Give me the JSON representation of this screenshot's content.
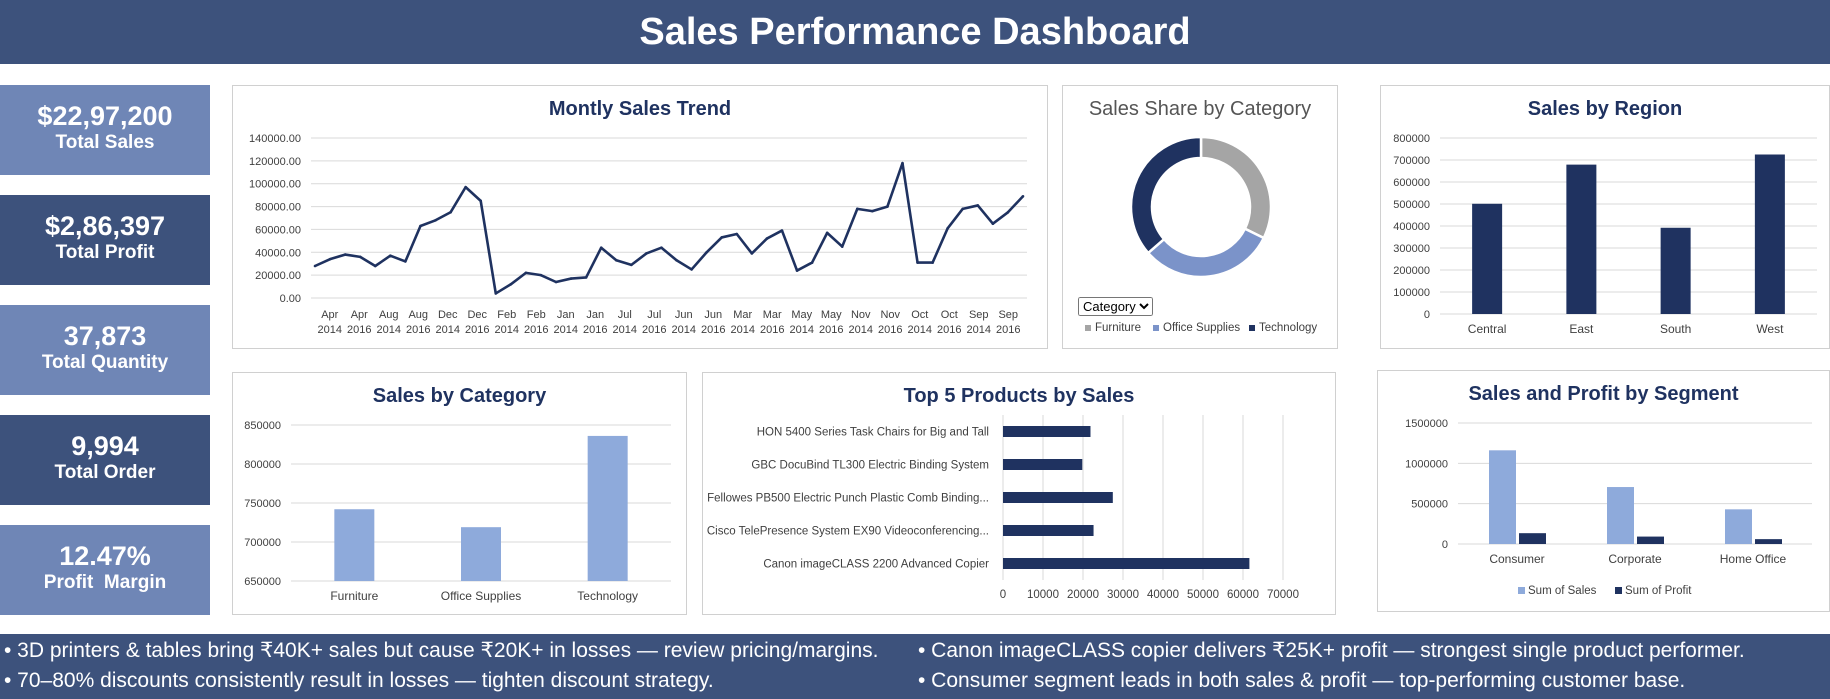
{
  "header": {
    "title": "Sales Performance Dashboard"
  },
  "kpis": [
    {
      "value": "$22,97,200",
      "label": "Total Sales",
      "style": "light"
    },
    {
      "value": "$2,86,397",
      "label": "Total Profit",
      "style": "dark"
    },
    {
      "value": "37,873",
      "label": "Total Quantity",
      "style": "light"
    },
    {
      "value": "9,994",
      "label": "Total Order",
      "style": "dark"
    },
    {
      "value": "12.47%",
      "label": "Profit  Margin",
      "style": "light"
    }
  ],
  "colors": {
    "header": "#3d527c",
    "kpi_light": "#6f86b6",
    "kpi_dark": "#3d527c",
    "navy": "#1f3260",
    "light_blue": "#8eaadb",
    "grey": "#a5a5a5",
    "mid_blue": "#7b93c9"
  },
  "share_filter": {
    "selected": "Category"
  },
  "insights": [
    "• 3D printers & tables bring ₹40K+ sales but cause ₹20K+ in losses — review pricing/margins.",
    "• 70–80% discounts consistently result in losses — tighten discount strategy.",
    "• Canon imageCLASS copier delivers ₹25K+ profit — strongest single product performer.",
    "• Consumer segment leads in both sales & profit — top-performing customer base."
  ],
  "chart_data": [
    {
      "id": "monthly",
      "type": "line",
      "title": "Montly Sales Trend",
      "ylim": [
        0,
        140000
      ],
      "yticks": [
        "0.00",
        "20000.00",
        "40000.00",
        "60000.00",
        "80000.00",
        "100000.00",
        "120000.00",
        "140000.00"
      ],
      "x_labels": [
        [
          "Apr",
          "2014"
        ],
        [
          "Apr",
          "2016"
        ],
        [
          "Aug",
          "2014"
        ],
        [
          "Aug",
          "2016"
        ],
        [
          "Dec",
          "2014"
        ],
        [
          "Dec",
          "2016"
        ],
        [
          "Feb",
          "2014"
        ],
        [
          "Feb",
          "2016"
        ],
        [
          "Jan",
          "2014"
        ],
        [
          "Jan",
          "2016"
        ],
        [
          "Jul",
          "2014"
        ],
        [
          "Jul",
          "2016"
        ],
        [
          "Jun",
          "2014"
        ],
        [
          "Jun",
          "2016"
        ],
        [
          "Mar",
          "2014"
        ],
        [
          "Mar",
          "2016"
        ],
        [
          "May",
          "2014"
        ],
        [
          "May",
          "2016"
        ],
        [
          "Nov",
          "2014"
        ],
        [
          "Nov",
          "2016"
        ],
        [
          "Oct",
          "2014"
        ],
        [
          "Oct",
          "2016"
        ],
        [
          "Sep",
          "2014"
        ],
        [
          "Sep",
          "2016"
        ]
      ],
      "values": [
        28000,
        34000,
        38000,
        36000,
        28000,
        37000,
        32000,
        63000,
        68000,
        75000,
        97000,
        85000,
        4000,
        12000,
        22000,
        20000,
        14000,
        17000,
        18000,
        44000,
        33000,
        29000,
        39000,
        44000,
        33000,
        25000,
        40000,
        53000,
        56000,
        39000,
        52000,
        59000,
        24000,
        31000,
        57000,
        45000,
        78000,
        76000,
        80000,
        118000,
        31000,
        31000,
        61000,
        78000,
        81000,
        65000,
        75000,
        89000
      ],
      "grid": true
    },
    {
      "id": "share",
      "type": "pie",
      "title": "Sales Share by Category",
      "categories": [
        "Furniture",
        "Office Supplies",
        "Technology"
      ],
      "values": [
        742000,
        719000,
        836000
      ],
      "legend": "bottom"
    },
    {
      "id": "region",
      "type": "bar",
      "title": "Sales by Region",
      "categories": [
        "Central",
        "East",
        "South",
        "West"
      ],
      "values": [
        501000,
        679000,
        392000,
        725000
      ],
      "ylim": [
        0,
        800000
      ],
      "yticks": [
        "0",
        "100000",
        "200000",
        "300000",
        "400000",
        "500000",
        "600000",
        "700000",
        "800000"
      ],
      "grid": true
    },
    {
      "id": "category",
      "type": "bar",
      "title": "Sales by Category",
      "categories": [
        "Furniture",
        "Office Supplies",
        "Technology"
      ],
      "values": [
        742000,
        719000,
        836000
      ],
      "ylim": [
        650000,
        850000
      ],
      "yticks": [
        "650000",
        "700000",
        "750000",
        "800000",
        "850000"
      ],
      "grid": true
    },
    {
      "id": "top5",
      "type": "bar",
      "title": "Top 5 Products by Sales",
      "categories": [
        "HON 5400 Series Task Chairs for Big and Tall",
        "GBC DocuBind TL300 Electric Binding System",
        "Fellowes PB500 Electric Punch Plastic Comb Binding...",
        "Cisco TelePresence System EX90 Videoconferencing...",
        "Canon imageCLASS 2200 Advanced Copier"
      ],
      "values": [
        21870,
        19823,
        27453,
        22638,
        61600
      ],
      "xlim": [
        0,
        70000
      ],
      "xticks": [
        "0",
        "10000",
        "20000",
        "30000",
        "40000",
        "50000",
        "60000",
        "70000"
      ],
      "grid": true
    },
    {
      "id": "segment",
      "type": "bar",
      "title": "Sales and Profit by Segment",
      "categories": [
        "Consumer",
        "Corporate",
        "Home Office"
      ],
      "series": [
        {
          "name": "Sum of Sales",
          "values": [
            1161400,
            706100,
            429700
          ]
        },
        {
          "name": "Sum of Profit",
          "values": [
            134100,
            91980,
            60300
          ]
        }
      ],
      "ylim": [
        0,
        1500000
      ],
      "yticks": [
        "0",
        "500000",
        "1000000",
        "1500000"
      ],
      "legend": "bottom",
      "grid": true
    }
  ]
}
